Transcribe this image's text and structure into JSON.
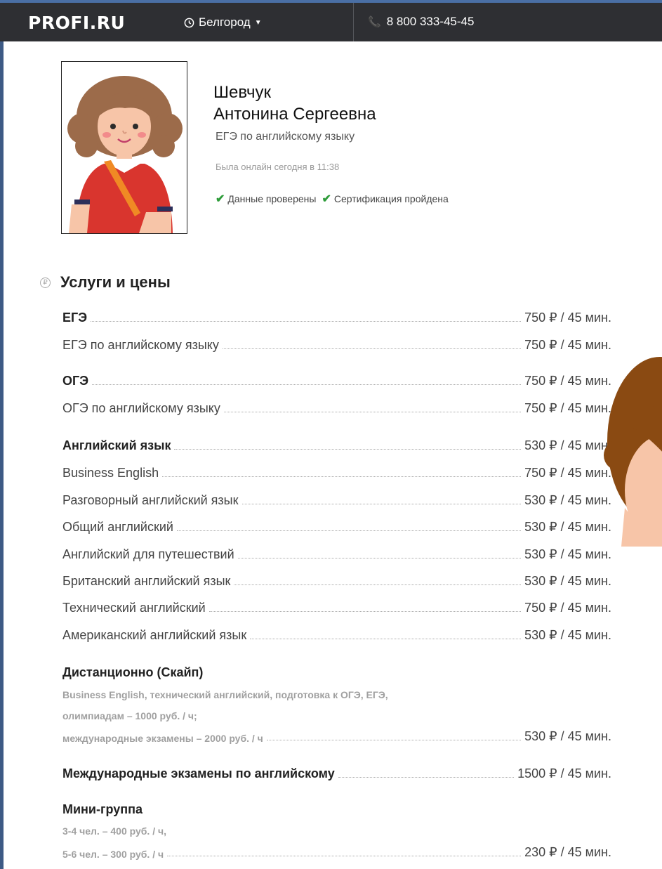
{
  "header": {
    "logo": "PROFI.RU",
    "city": "Белгород",
    "phone": "8 800 333-45-45"
  },
  "profile": {
    "last_name": "Шевчук",
    "first_name": "Антонина Сергеевна",
    "subject": "ЕГЭ по английскому языку",
    "online": "Была онлайн сегодня в 11:38",
    "badge_verified": "Данные проверены",
    "badge_certified": "Сертификация пройдена"
  },
  "services": {
    "title": "Услуги и цены",
    "rows": [
      {
        "label": "ЕГЭ",
        "price": "750 ₽ / 45 мин."
      },
      {
        "label": "ЕГЭ по английскому языку",
        "price": "750 ₽ / 45 мин."
      },
      {
        "label": "ОГЭ",
        "price": "750 ₽ / 45 мин."
      },
      {
        "label": "ОГЭ по английскому языку",
        "price": "750 ₽ / 45 мин."
      },
      {
        "label": "Английский язык",
        "price": "530 ₽ / 45 мин."
      },
      {
        "label": "Business English",
        "price": "750 ₽ / 45 мин."
      },
      {
        "label": "Разговорный английский язык",
        "price": "530 ₽ / 45 мин."
      },
      {
        "label": "Общий английский",
        "price": "530 ₽ / 45 мин."
      },
      {
        "label": "Английский для путешествий",
        "price": "530 ₽ / 45 мин."
      },
      {
        "label": "Британский английский язык",
        "price": "530 ₽ / 45 мин."
      },
      {
        "label": "Технический английский",
        "price": "750 ₽ / 45 мин."
      },
      {
        "label": "Американский английский язык",
        "price": "530 ₽ / 45 мин."
      }
    ],
    "remote": {
      "title": "Дистанционно (Скайп)",
      "note1": "Business English, технический английский, подготовка к ОГЭ, ЕГЭ,",
      "note2": "олимпиадам – 1000 руб. / ч;",
      "note3": "международные экзамены – 2000 руб. / ч",
      "price": "530 ₽ / 45 мин."
    },
    "intl": {
      "label": "Международные экзамены по английскому",
      "price": "1500 ₽ / 45 мин."
    },
    "mini": {
      "title": "Мини-группа",
      "note1": "3-4 чел. – 400 руб. / ч,",
      "note2": "5-6 чел. – 300 руб. / ч",
      "price": "230 ₽ / 45 мин."
    }
  }
}
